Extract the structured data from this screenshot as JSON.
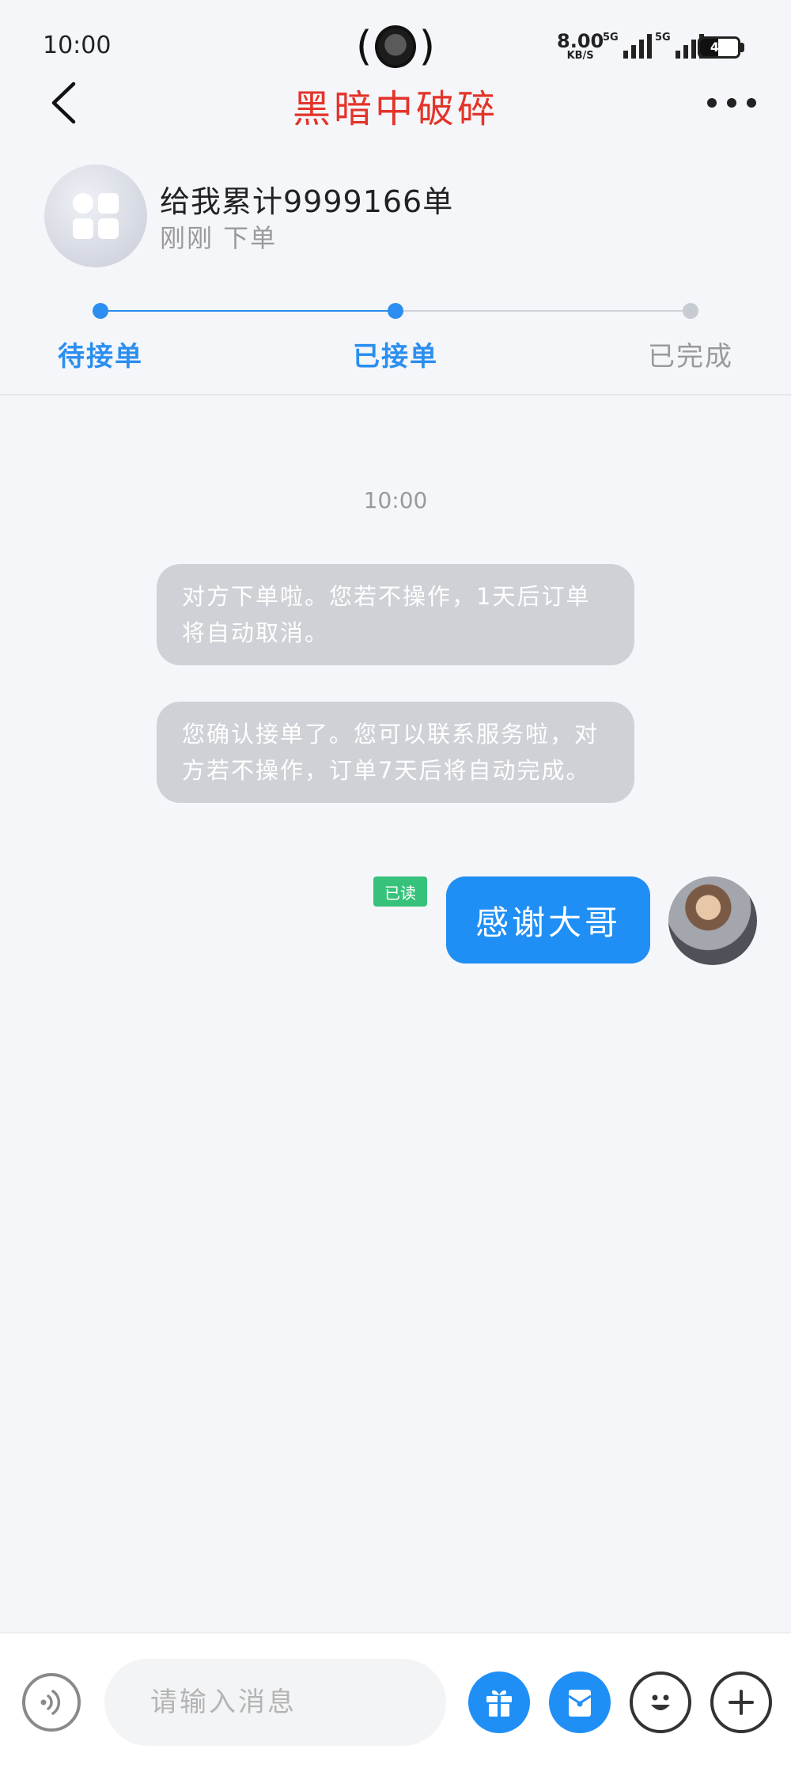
{
  "status_bar": {
    "time": "10:00",
    "net_speed_value": "8.00",
    "net_speed_unit": "KB/S",
    "sim1_tag": "5G",
    "sim2_tag": "5G",
    "battery_level": 47,
    "battery_label": "47"
  },
  "nav": {
    "title": "黑暗中破碎",
    "back_icon": "chevron-left-icon",
    "more_icon": "more-dots-icon"
  },
  "order": {
    "title": "给我累计9999166单",
    "subtitle": "刚刚 下单",
    "avatar_icon": "app-grid-icon"
  },
  "progress": {
    "steps": [
      {
        "label": "待接单",
        "state": "done"
      },
      {
        "label": "已接单",
        "state": "current"
      },
      {
        "label": "已完成",
        "state": "todo"
      }
    ],
    "active_color": "#2b8ef0",
    "inactive_color": "#9a9a9a"
  },
  "chat": {
    "time": "10:00",
    "system_messages": [
      "对方下单啦。您若不操作，1天后订单将自动取消。",
      "您确认接单了。您可以联系服务啦，对方若不操作，订单7天后将自动完成。"
    ],
    "my_message": "感谢大哥",
    "read_label": "已读",
    "bubble_color": "#1f8ff5",
    "read_badge_color": "#36c27a"
  },
  "input_bar": {
    "placeholder": "请输入消息",
    "voice_icon": "voice-icon",
    "gift_icon": "gift-icon",
    "red_packet_icon": "red-packet-icon",
    "emoji_icon": "emoji-icon",
    "plus_icon": "plus-icon"
  }
}
